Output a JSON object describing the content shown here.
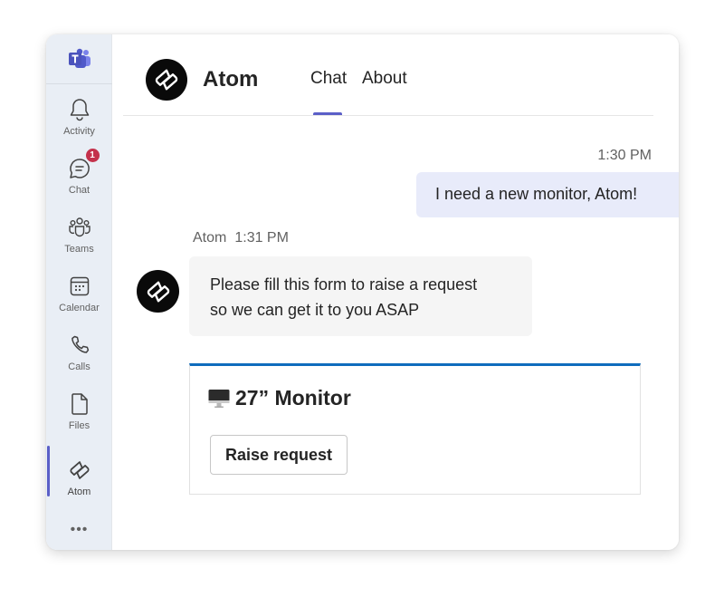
{
  "rail": {
    "logo_icon": "teams-logo-icon",
    "items": [
      {
        "id": "activity",
        "label": "Activity",
        "icon": "bell-icon"
      },
      {
        "id": "chat",
        "label": "Chat",
        "icon": "chat-icon",
        "badge": "1"
      },
      {
        "id": "teams",
        "label": "Teams",
        "icon": "people-icon"
      },
      {
        "id": "calendar",
        "label": "Calendar",
        "icon": "calendar-icon"
      },
      {
        "id": "calls",
        "label": "Calls",
        "icon": "phone-icon"
      },
      {
        "id": "files",
        "label": "Files",
        "icon": "file-icon"
      },
      {
        "id": "atom",
        "label": "Atom",
        "icon": "atom-logo-icon",
        "active": true
      }
    ],
    "more_label": "•••"
  },
  "header": {
    "app_name": "Atom",
    "tabs": [
      {
        "label": "Chat",
        "active": true
      },
      {
        "label": "About",
        "active": false
      }
    ]
  },
  "conversation": {
    "user_message": {
      "time": "1:30 PM",
      "text": "I need a new monitor, Atom!"
    },
    "bot_message": {
      "sender": "Atom",
      "time": "1:31 PM",
      "lines": [
        "Please fill this form to raise a request",
        "so we can get it to you ASAP"
      ]
    },
    "card": {
      "icon": "monitor-icon",
      "title": "27” Monitor",
      "button_label": "Raise request"
    }
  },
  "colors": {
    "accent": "#5b5fc7",
    "badge": "#c4314b",
    "card_top_border": "#0f6cbd",
    "user_bubble": "#e8ebfa",
    "bot_bubble": "#f5f5f5",
    "rail_bg": "#e9eef5"
  }
}
